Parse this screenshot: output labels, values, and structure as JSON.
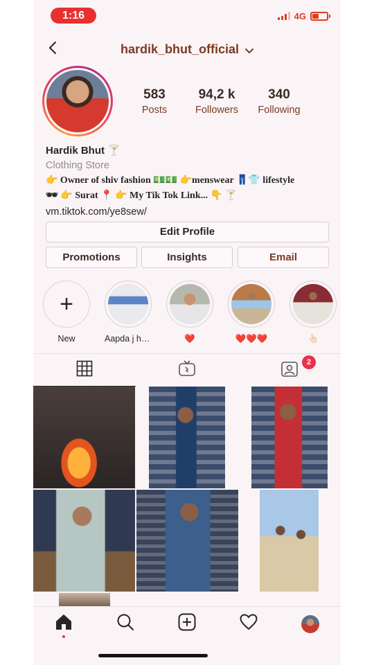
{
  "status_bar": {
    "time": "1:16",
    "network": "4G",
    "colors": {
      "pill": "#e8312f",
      "indicator": "#d9401e"
    }
  },
  "header": {
    "username": "hardik_bhut_official"
  },
  "profile": {
    "stats": [
      {
        "number": "583",
        "label": "Posts"
      },
      {
        "number": "94,2 k",
        "label": "Followers"
      },
      {
        "number": "340",
        "label": "Following"
      }
    ],
    "name": "Hardik Bhut 🍸",
    "category": "Clothing Store",
    "bio_line_1": "👉 Owner of shiv fashion 💵💵 👉menswear 👖👕 lifestyle",
    "bio_line_2": "🕶 👉 Surat 📍 👉 My Tik Tok Link... 👇 🍸",
    "link": "vm.tiktok.com/ye8sew/"
  },
  "buttons": {
    "edit_profile": "Edit Profile",
    "promotions": "Promotions",
    "insights": "Insights",
    "email": "Email"
  },
  "highlights": [
    {
      "label": "New",
      "icon": "plus-icon"
    },
    {
      "label": "Aapda j hoi..."
    },
    {
      "label": "❤️"
    },
    {
      "label": "❤️❤️❤️"
    },
    {
      "label": "👆🏻"
    }
  ],
  "tabs": [
    {
      "icon": "grid-icon",
      "active": true
    },
    {
      "icon": "igtv-icon",
      "active": false
    },
    {
      "icon": "tagged-icon",
      "active": false,
      "badge": "2"
    }
  ],
  "bottom_nav": [
    {
      "icon": "home-icon",
      "active": true
    },
    {
      "icon": "search-icon"
    },
    {
      "icon": "add-post-icon"
    },
    {
      "icon": "heart-icon"
    },
    {
      "icon": "profile-avatar"
    }
  ],
  "colors": {
    "accent": "#7a3b23",
    "badge": "#e8334a",
    "background": "#fbf4f6"
  }
}
